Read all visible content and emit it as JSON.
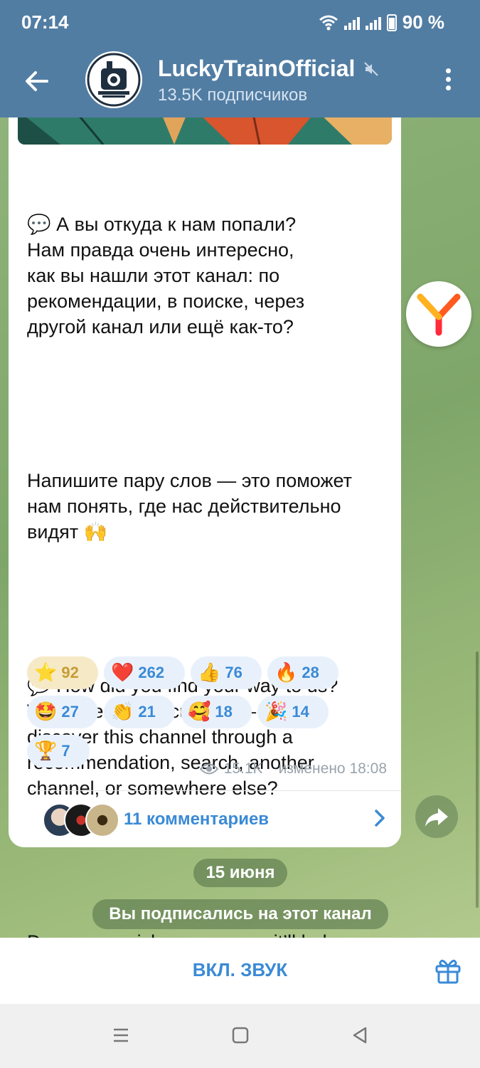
{
  "status": {
    "time": "07:14",
    "battery": "90 %"
  },
  "header": {
    "back_label": "←",
    "channel_name": "LuckyTrainOfficial",
    "subscribers": "13.5K подписчиков"
  },
  "message": {
    "text_ru_1": "💬 А вы откуда к нам попали?\nНам правда очень интересно,\nкак вы нашли этот канал: по\nрекомендации, в поиске, через\nдругой канал или ещё как-то?",
    "text_ru_2": "Напишите пару слов — это поможет\nнам понять, где нас действительно\nвидят 🙌",
    "text_en_1": "💬 How did you find your way to us?\nWe’re genuinely curious — did you\ndiscover this channel through a\nrecommendation, search, another\nchannel, or somewhere else?",
    "text_en_2": "Drop us a quick message — it’ll help\nus understand where people are\nactually finding us 🙌",
    "reactions": [
      {
        "emoji": "⭐",
        "count": "92"
      },
      {
        "emoji": "❤️",
        "count": "262"
      },
      {
        "emoji": "👍",
        "count": "76"
      },
      {
        "emoji": "🔥",
        "count": "28"
      },
      {
        "emoji": "🤩",
        "count": "27"
      },
      {
        "emoji": "👏",
        "count": "21"
      },
      {
        "emoji": "🥰",
        "count": "18"
      },
      {
        "emoji": "🎉",
        "count": "14"
      },
      {
        "emoji": "🏆",
        "count": "7"
      }
    ],
    "views": "15.1K",
    "edited": "изменено 18:08",
    "comments_label": "11 комментариев"
  },
  "chat": {
    "date_pill": "15 июня",
    "service_message": "Вы подписались на этот канал"
  },
  "bottom": {
    "sound_button": "ВКЛ. ЗВУК"
  },
  "colors": {
    "header": "#527da3",
    "link": "#3a8ad6"
  }
}
